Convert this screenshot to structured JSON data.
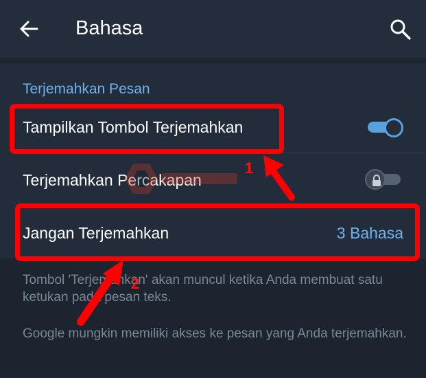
{
  "appbar": {
    "title": "Bahasa"
  },
  "section": {
    "header": "Terjemahkan Pesan",
    "rows": [
      {
        "label": "Tampilkan Tombol Terjemahkan",
        "toggle": "on"
      },
      {
        "label": "Terjemahkan Percakapan",
        "toggle": "locked"
      },
      {
        "label": "Jangan Terjemahkan",
        "value": "3 Bahasa"
      }
    ]
  },
  "info": {
    "line1": "Tombol 'Terjemahkan' akan muncul ketika Anda membuat satu ketukan pada pesan teks.",
    "line2": "Google mungkin memiliki akses ke pesan yang Anda terjemahkan."
  },
  "annotations": {
    "one": "1",
    "two": "2"
  },
  "colors": {
    "accent": "#6fb2ee",
    "highlight": "#ff0000",
    "background": "#1c2430"
  },
  "icons": [
    "back-arrow-icon",
    "search-icon",
    "lock-icon",
    "watermark-logo"
  ]
}
